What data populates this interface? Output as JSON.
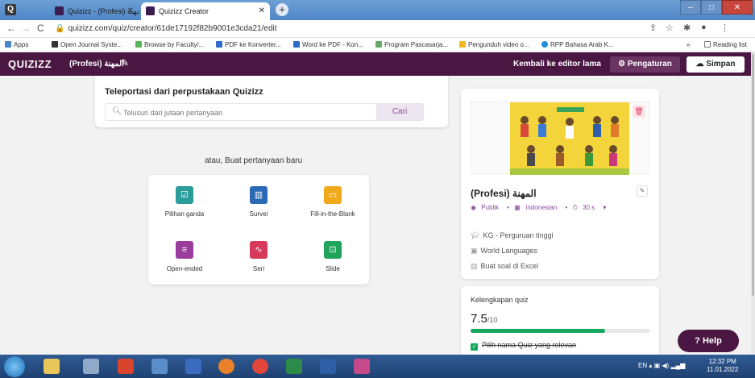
{
  "browser": {
    "tabs": [
      {
        "label": "Quizizz - (Profesi) المهنة",
        "active": false
      },
      {
        "label": "Quizizz Creator",
        "active": true
      }
    ],
    "url": "quizizz.com/quiz/creator/61de17192f82b9001e3cda21/edit",
    "bookmarks": [
      {
        "label": "Apps",
        "icon": "apps-icon"
      },
      {
        "label": "Open Journal Syste...",
        "icon": "pkp-icon"
      },
      {
        "label": "Browse by Faculty/...",
        "icon": "browse-icon"
      },
      {
        "label": "PDF ke Konverter...",
        "icon": "pdf-icon"
      },
      {
        "label": "Word ke PDF - Kon...",
        "icon": "word-icon"
      },
      {
        "label": "Program Pascasarja...",
        "icon": "program-icon"
      },
      {
        "label": "Pengunduh video o...",
        "icon": "download-icon"
      },
      {
        "label": "RPP Bahasa Arab K...",
        "icon": "rpp-icon"
      }
    ],
    "reading_list": "Reading list"
  },
  "header": {
    "logo": "QUIZIZZ",
    "quiz_title": "(Profesi) المهنة",
    "editor_link": "Kembali ke editor lama",
    "settings_label": "Pengaturan",
    "save_label": "Simpan",
    "brand_color": "#4a1642"
  },
  "teleport": {
    "title": "Teleportasi dari perpustakaan Quizizz",
    "search_placeholder": "Telusuri dari jutaan pertanyaan",
    "search_button": "Cari"
  },
  "create": {
    "heading": "atau, Buat pertanyaan baru",
    "types": [
      {
        "label": "Pilihan ganda",
        "icon": "checkbox-icon",
        "color": "#2a9d9a"
      },
      {
        "label": "Survei",
        "icon": "bar-chart-icon",
        "color": "#2a69b5"
      },
      {
        "label": "Fill-in-the-Blank",
        "icon": "blank-field-icon",
        "color": "#f1a91a"
      },
      {
        "label": "Open-ended",
        "icon": "text-lines-icon",
        "color": "#9a3d9c"
      },
      {
        "label": "Seri",
        "icon": "wave-icon",
        "color": "#d63a5b"
      },
      {
        "label": "Slide",
        "icon": "presentation-icon",
        "color": "#20a35a"
      }
    ]
  },
  "preview": {
    "title": "(Profesi) المهنة",
    "visibility": "Publik",
    "language": "Indonesian",
    "time": "30 s",
    "grade": "KG - Perguruan tinggi",
    "subject": "World Languages",
    "excel_link": "Buat soal di Excel"
  },
  "completeness": {
    "title": "Kelengkapan quiz",
    "score": "7.5",
    "out_of": "/10",
    "progress_fraction": 0.75,
    "item": "Pilih nama Quiz yang relevan"
  },
  "help_label": "Help",
  "taskbar": {
    "lang": "EN",
    "time": "12:32 PM",
    "date": "11.01.2022"
  }
}
